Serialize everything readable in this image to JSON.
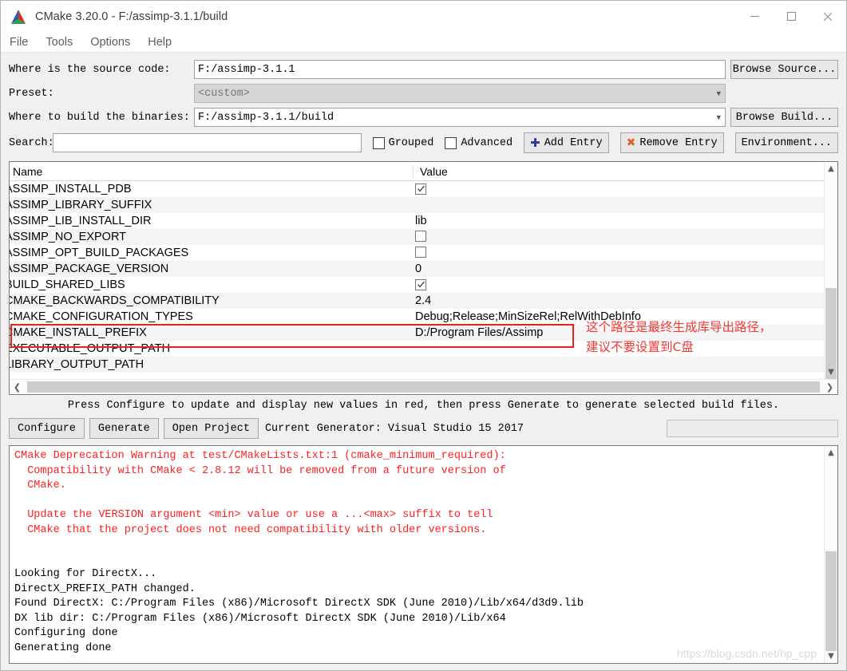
{
  "window": {
    "title": "CMake 3.20.0 - F:/assimp-3.1.1/build",
    "app_icon": "cmake-logo-icon",
    "minimize_label": "—",
    "maximize_label": "□",
    "close_label": "✕"
  },
  "menu": {
    "items": [
      {
        "label": "File"
      },
      {
        "label": "Tools"
      },
      {
        "label": "Options"
      },
      {
        "label": "Help"
      }
    ]
  },
  "form": {
    "source_label": "Where is the source code:",
    "source_value": "F:/assimp-3.1.1",
    "browse_source_label": "Browse Source...",
    "preset_label": "Preset:",
    "preset_value": "<custom>",
    "binaries_label": "Where to build the binaries:",
    "binaries_value": "F:/assimp-3.1.1/build",
    "browse_build_label": "Browse Build...",
    "search_label": "Search:",
    "search_value": "",
    "search_placeholder": "",
    "grouped_label": "Grouped",
    "grouped_checked": false,
    "advanced_label": "Advanced",
    "advanced_checked": false,
    "add_entry_label": "Add Entry",
    "add_entry_icon": "plus-icon",
    "remove_entry_label": "Remove Entry",
    "remove_entry_icon": "x-mark-icon",
    "environment_label": "Environment..."
  },
  "table": {
    "col_name": "Name",
    "col_value": "Value",
    "rows": [
      {
        "name": "ASSIMP_INSTALL_PDB",
        "value": "",
        "type": "checkbox",
        "checked": true
      },
      {
        "name": "ASSIMP_LIBRARY_SUFFIX",
        "value": "",
        "type": "text",
        "checked": false
      },
      {
        "name": "ASSIMP_LIB_INSTALL_DIR",
        "value": "lib",
        "type": "text",
        "checked": false
      },
      {
        "name": "ASSIMP_NO_EXPORT",
        "value": "",
        "type": "checkbox",
        "checked": false
      },
      {
        "name": "ASSIMP_OPT_BUILD_PACKAGES",
        "value": "",
        "type": "checkbox",
        "checked": false
      },
      {
        "name": "ASSIMP_PACKAGE_VERSION",
        "value": "0",
        "type": "text",
        "checked": false
      },
      {
        "name": "BUILD_SHARED_LIBS",
        "value": "",
        "type": "checkbox",
        "checked": true
      },
      {
        "name": "CMAKE_BACKWARDS_COMPATIBILITY",
        "value": "2.4",
        "type": "text",
        "checked": false
      },
      {
        "name": "CMAKE_CONFIGURATION_TYPES",
        "value": "Debug;Release;MinSizeRel;RelWithDebInfo",
        "type": "text",
        "checked": false
      },
      {
        "name": "CMAKE_INSTALL_PREFIX",
        "value": "D:/Program Files/Assimp",
        "type": "text",
        "checked": false
      },
      {
        "name": "EXECUTABLE_OUTPUT_PATH",
        "value": "",
        "type": "text",
        "checked": false
      },
      {
        "name": "LIBRARY_OUTPUT_PATH",
        "value": "",
        "type": "text",
        "checked": false
      }
    ],
    "scroll_up_icon": "chevron-up-icon",
    "scroll_down_icon": "chevron-down-icon",
    "scroll_left_icon": "chevron-left-icon",
    "scroll_right_icon": "chevron-right-icon"
  },
  "annotation": {
    "color": "#ef3a36",
    "line1": "这个路径是最终生成库导出路径，",
    "line2": "建议不要设置到C盘"
  },
  "actions": {
    "hint": "Press Configure to update and display new values in red, then press Generate to generate selected build files.",
    "configure_label": "Configure",
    "generate_label": "Generate",
    "open_project_label": "Open Project",
    "generator_text": "Current Generator: Visual Studio 15 2017"
  },
  "log": {
    "warning_color": "#ff1f1f",
    "warning_lines": [
      "CMake Deprecation Warning at test/CMakeLists.txt:1 (cmake_minimum_required):",
      "  Compatibility with CMake < 2.8.12 will be removed from a future version of",
      "  CMake.",
      "",
      "  Update the VERSION argument <min> value or use a ...<max> suffix to tell",
      "  CMake that the project does not need compatibility with older versions.",
      ""
    ],
    "normal_lines": [
      "",
      "Looking for DirectX...",
      "DirectX_PREFIX_PATH changed.",
      "Found DirectX: C:/Program Files (x86)/Microsoft DirectX SDK (June 2010)/Lib/x64/d3d9.lib",
      "DX lib dir: C:/Program Files (x86)/Microsoft DirectX SDK (June 2010)/Lib/x64",
      "Configuring done",
      "Generating done"
    ],
    "watermark": "https://blog.csdn.net/hp_cpp"
  }
}
